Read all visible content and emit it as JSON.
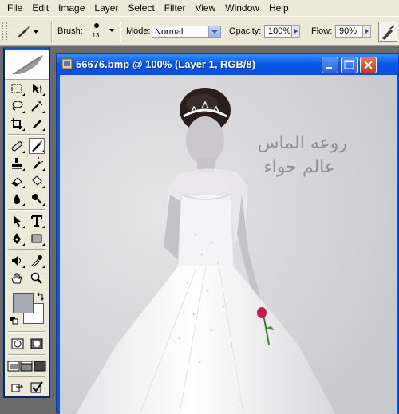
{
  "menubar": {
    "items": [
      "File",
      "Edit",
      "Image",
      "Layer",
      "Select",
      "Filter",
      "View",
      "Window",
      "Help"
    ]
  },
  "options": {
    "brush_label": "Brush:",
    "brush_size": "13",
    "mode_label": "Mode:",
    "mode_value": "Normal",
    "opacity_label": "Opacity:",
    "opacity_value": "100%",
    "flow_label": "Flow:",
    "flow_value": "90%"
  },
  "document": {
    "title": "56676.bmp @ 100% (Layer 1, RGB/8)",
    "watermark_line1": "روعه الماس",
    "watermark_line2": "عالم حواء"
  },
  "colors": {
    "foreground": "#a9a9b5",
    "background": "#ffffff",
    "titlebar": "#0758e9"
  },
  "toolbox": {
    "tools": [
      "marquee-tool-icon",
      "move-tool-icon",
      "lasso-tool-icon",
      "magic-wand-icon",
      "crop-tool-icon",
      "slice-tool-icon",
      "healing-brush-icon",
      "brush-tool-icon",
      "clone-stamp-icon",
      "history-brush-icon",
      "eraser-tool-icon",
      "paint-bucket-icon",
      "blur-tool-icon",
      "dodge-tool-icon",
      "path-select-icon",
      "type-tool-icon",
      "pen-tool-icon",
      "shape-tool-icon",
      "notes-tool-icon",
      "eyedropper-icon",
      "hand-tool-icon",
      "zoom-tool-icon"
    ]
  }
}
